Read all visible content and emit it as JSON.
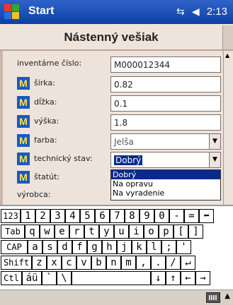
{
  "taskbar": {
    "start_label": "Start",
    "signal_icon": "⇆",
    "volume_icon": "◀",
    "time": "2:13"
  },
  "header": {
    "title": "Nástenný vešiak"
  },
  "form": {
    "inventory_label": "inventárne číslo:",
    "inventory_value": "M000012344",
    "width_label": "šírka:",
    "width_value": "0.82",
    "length_label": "dĺžka:",
    "length_value": "0.1",
    "height_label": "výška:",
    "height_value": "1.8",
    "color_label": "farba:",
    "color_value": "Jelša",
    "tech_state_label": "technický stav:",
    "tech_state_value": "Dobrý",
    "status_label": "štatút:",
    "producer_label": "výrobca:",
    "m_badge": "M"
  },
  "dropdown_list": {
    "options": [
      "Dobrý",
      "Na opravu",
      "Na vyradenie"
    ],
    "selected_index": 0
  },
  "keyboard": {
    "rows": [
      [
        "123",
        "1",
        "2",
        "3",
        "4",
        "5",
        "6",
        "7",
        "8",
        "9",
        "0",
        "-",
        "=",
        "⬅"
      ],
      [
        "Tab",
        "q",
        "w",
        "e",
        "r",
        "t",
        "y",
        "u",
        "i",
        "o",
        "p",
        "[",
        "]"
      ],
      [
        "CAP",
        "a",
        "s",
        "d",
        "f",
        "g",
        "h",
        "j",
        "k",
        "l",
        ";",
        "'"
      ],
      [
        "Shift",
        "z",
        "x",
        "c",
        "v",
        "b",
        "n",
        "m",
        ",",
        ".",
        "/",
        "↵"
      ],
      [
        "Ctl",
        "áü",
        "`",
        "\\",
        "",
        "↓",
        "↑",
        "←",
        "→"
      ]
    ]
  }
}
